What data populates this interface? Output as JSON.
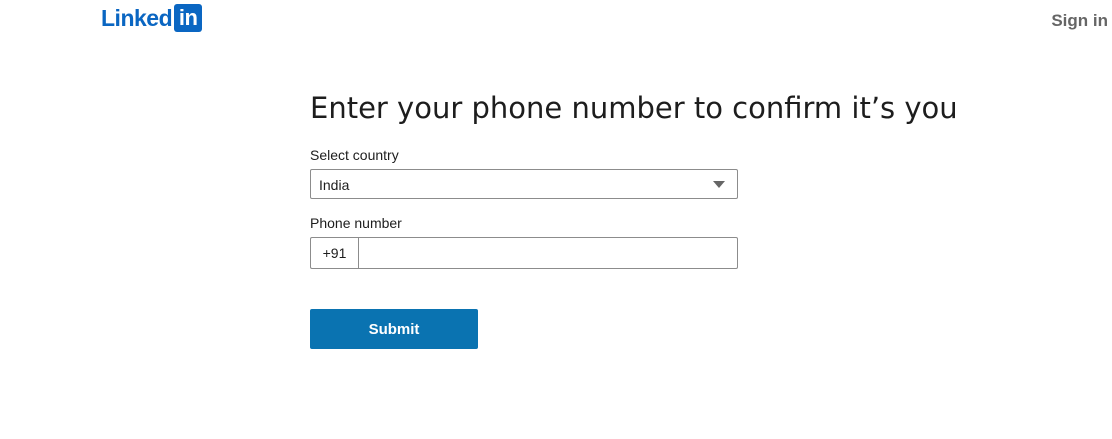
{
  "header": {
    "logo_text": "Linked",
    "logo_box_text": "in",
    "signin_label": "Sign in"
  },
  "main": {
    "title": "Enter your phone number to confirm it’s you",
    "country_label": "Select country",
    "country_value": "India",
    "phone_label": "Phone number",
    "phone_prefix": "+91",
    "phone_value": "",
    "phone_placeholder": "",
    "submit_label": "Submit"
  },
  "colors": {
    "brand": "#0a66c2",
    "button": "#0a73b1",
    "signin_text": "#666666"
  },
  "icons": {
    "dropdown": "caret-down-icon"
  }
}
